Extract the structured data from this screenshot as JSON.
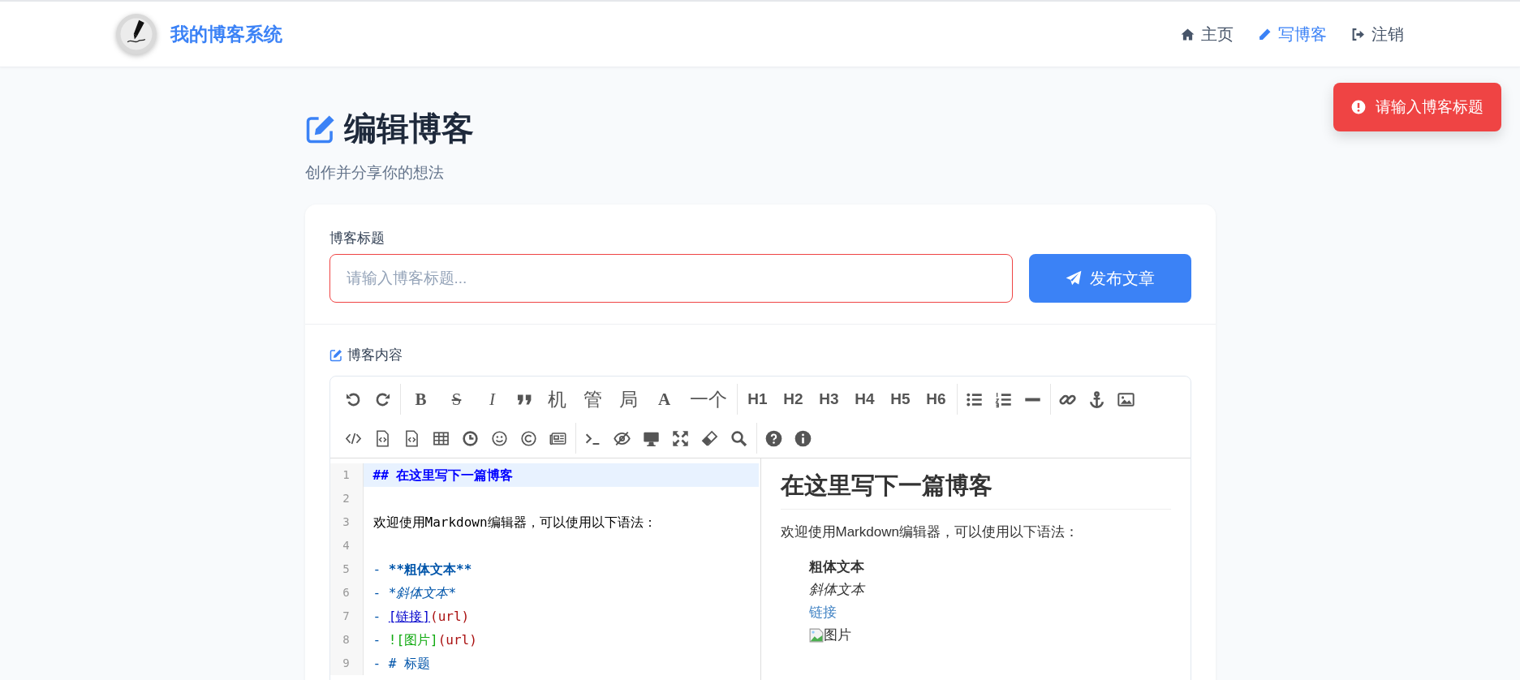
{
  "header": {
    "site_title": "我的博客系统",
    "nav": [
      {
        "label": "主页",
        "selected": false,
        "kind": "home"
      },
      {
        "label": "写博客",
        "selected": true,
        "kind": "write"
      },
      {
        "label": "注销",
        "selected": false,
        "kind": "logout"
      }
    ]
  },
  "toast": {
    "kind": "error",
    "message": "请输入博客标题"
  },
  "page": {
    "title": "编辑博客",
    "subtitle": "创作并分享你的想法"
  },
  "form": {
    "title_label": "博客标题",
    "title_field": {
      "placeholder": "请输入博客标题...",
      "error": true
    },
    "publish_button": "发布文章",
    "content_label": "博客内容"
  },
  "editor": {
    "toolbar": [
      [
        [
          {
            "kind": "icon"
          },
          {
            "kind": "icon"
          }
        ],
        [
          {
            "kind": "text",
            "label": "B"
          },
          {
            "kind": "text",
            "label": "S"
          },
          {
            "kind": "text",
            "label": "I"
          },
          {
            "kind": "icon"
          },
          {
            "kind": "text",
            "label": "机"
          },
          {
            "kind": "text",
            "label": "管"
          },
          {
            "kind": "text",
            "label": "局"
          },
          {
            "kind": "text",
            "label": "A"
          },
          {
            "kind": "text",
            "label": "一个"
          }
        ],
        [
          {
            "kind": "text",
            "label": "H1"
          },
          {
            "kind": "text",
            "label": "H2"
          },
          {
            "kind": "text",
            "label": "H3"
          },
          {
            "kind": "text",
            "label": "H4"
          },
          {
            "kind": "text",
            "label": "H5"
          },
          {
            "kind": "text",
            "label": "H6"
          }
        ],
        [
          {
            "kind": "icon"
          },
          {
            "kind": "icon"
          },
          {
            "kind": "icon"
          }
        ],
        [
          {
            "kind": "icon"
          },
          {
            "kind": "icon"
          },
          {
            "kind": "icon"
          }
        ]
      ],
      [
        [
          {
            "kind": "icon"
          },
          {
            "kind": "icon"
          },
          {
            "kind": "icon"
          },
          {
            "kind": "icon"
          },
          {
            "kind": "icon"
          },
          {
            "kind": "icon"
          },
          {
            "kind": "icon"
          },
          {
            "kind": "icon"
          }
        ],
        [
          {
            "kind": "icon"
          },
          {
            "kind": "icon"
          },
          {
            "kind": "icon"
          },
          {
            "kind": "icon"
          },
          {
            "kind": "icon"
          },
          {
            "kind": "icon"
          }
        ],
        [
          {
            "kind": "icon"
          },
          {
            "kind": "icon"
          }
        ]
      ]
    ],
    "lines": [
      {
        "number": "1",
        "active": true,
        "segments": [
          {
            "kind": "header",
            "text": "## 在这里写下一篇博客"
          }
        ]
      },
      {
        "number": "2",
        "active": false
      },
      {
        "number": "3",
        "active": false,
        "segments": [
          {
            "kind": "plain",
            "text": "欢迎使用Markdown编辑器，可以使用以下语法："
          }
        ]
      },
      {
        "number": "4",
        "active": false
      },
      {
        "number": "5",
        "active": false,
        "segments": [
          {
            "kind": "marker",
            "text": "- "
          },
          {
            "kind": "strong",
            "text": "**粗体文本**"
          }
        ]
      },
      {
        "number": "6",
        "active": false,
        "segments": [
          {
            "kind": "marker",
            "text": "- "
          },
          {
            "kind": "em",
            "text": "*斜体文本*"
          }
        ]
      },
      {
        "number": "7",
        "active": false,
        "segments": [
          {
            "kind": "marker",
            "text": "- "
          },
          {
            "kind": "link",
            "text": "[链接]"
          },
          {
            "kind": "url",
            "text": "(url)"
          }
        ]
      },
      {
        "number": "8",
        "active": false,
        "segments": [
          {
            "kind": "marker",
            "text": "- "
          },
          {
            "kind": "image",
            "text": "![图片]"
          },
          {
            "kind": "url",
            "text": "(url)"
          }
        ]
      },
      {
        "number": "9",
        "active": false,
        "segments": [
          {
            "kind": "marker",
            "text": "- # 标题"
          }
        ]
      }
    ],
    "preview": {
      "heading": "在这里写下一篇博客",
      "paragraph": "欢迎使用Markdown编辑器，可以使用以下语法：",
      "items": [
        {
          "kind": "bold",
          "text": "粗体文本"
        },
        {
          "kind": "italic",
          "text": "斜体文本"
        },
        {
          "kind": "link",
          "text": "链接"
        },
        {
          "kind": "image",
          "text": "图片"
        }
      ]
    }
  }
}
